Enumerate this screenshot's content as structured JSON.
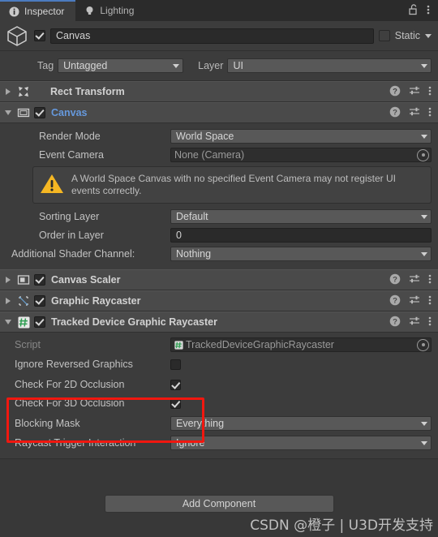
{
  "window": {
    "tabs": [
      {
        "label": "Inspector",
        "icon": "info-icon",
        "active": true
      },
      {
        "label": "Lighting",
        "icon": "lightbulb-icon",
        "active": false
      }
    ],
    "lock_icon": "padlock-open-icon",
    "menu_icon": "kebab-menu-icon"
  },
  "object_header": {
    "prefab_icon": "cube-prefab-icon",
    "enabled": true,
    "name": "Canvas",
    "static_checked": false,
    "static_label": "Static"
  },
  "tag_layer": {
    "tag_label": "Tag",
    "tag_value": "Untagged",
    "layer_label": "Layer",
    "layer_value": "UI"
  },
  "components": [
    {
      "name": "Rect Transform",
      "icon": "rect-transform-icon",
      "expanded": false,
      "has_enable_toggle": false
    },
    {
      "name": "Canvas",
      "icon": "canvas-icon",
      "expanded": true,
      "has_enable_toggle": true,
      "enabled": true,
      "title_is_link": true
    },
    {
      "name": "Canvas Scaler",
      "icon": "canvas-scaler-icon",
      "expanded": false,
      "has_enable_toggle": true,
      "enabled": true
    },
    {
      "name": "Graphic Raycaster",
      "icon": "graphic-raycaster-icon",
      "expanded": false,
      "has_enable_toggle": true,
      "enabled": true
    },
    {
      "name": "Tracked Device Graphic Raycaster",
      "icon": "script-hash-icon",
      "expanded": true,
      "has_enable_toggle": true,
      "enabled": true
    }
  ],
  "header_icons": {
    "help": "help-question-icon",
    "preset": "preset-sliders-icon",
    "menu": "kebab-menu-icon"
  },
  "canvas_component": {
    "render_mode": {
      "label": "Render Mode",
      "value": "World Space"
    },
    "event_camera": {
      "label": "Event Camera",
      "value": "None (Camera)"
    },
    "warning": "A World Space Canvas with no specified Event Camera may not register UI events correctly.",
    "warning_icon": "warning-triangle-icon",
    "sorting_layer": {
      "label": "Sorting Layer",
      "value": "Default"
    },
    "order_in_layer": {
      "label": "Order in Layer",
      "value": "0"
    },
    "additional_shader_channels": {
      "label": "Additional Shader Channel:",
      "value": "Nothing"
    }
  },
  "tracked_device_raycaster": {
    "script": {
      "label": "Script",
      "value": "TrackedDeviceGraphicRaycaster",
      "icon": "script-hash-icon"
    },
    "ignore_reversed_graphics": {
      "label": "Ignore Reversed Graphics",
      "checked": false
    },
    "check_2d_occlusion": {
      "label": "Check For 2D Occlusion",
      "checked": true
    },
    "check_3d_occlusion": {
      "label": "Check For 3D Occlusion",
      "checked": true
    },
    "blocking_mask": {
      "label": "Blocking Mask",
      "value": "Everything"
    },
    "raycast_trigger_interaction": {
      "label": "Raycast Trigger Interaction",
      "value": "Ignore"
    }
  },
  "footer": {
    "add_component_label": "Add Component"
  },
  "watermark": {
    "text": "CSDN @橙子 | U3D开发支持"
  },
  "colors": {
    "highlight": "#f1170f",
    "panel": "#3c3c3c",
    "header": "#4a4a4a",
    "link": "#6699dd",
    "warning": "#f5b723",
    "tab_accent": "#4b7bbf"
  }
}
